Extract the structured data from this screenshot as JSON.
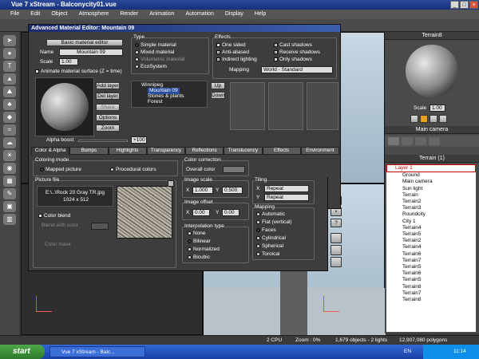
{
  "window": {
    "title": "Vue 7 xStream - Balconycity01.vue",
    "minimize": "_",
    "maximize": "□",
    "close": "×"
  },
  "menu": [
    "File",
    "Edit",
    "Object",
    "Atmosphere",
    "Render",
    "Animation",
    "Automation",
    "Display",
    "Help"
  ],
  "editor": {
    "title": "Advanced Material Editor: Mountain 09",
    "basic_button": "Basic material editor",
    "name_label": "Name",
    "name_value": "Mountain 09",
    "scale_label": "Scale",
    "scale_value": "1.00",
    "animate_label": "Animate material surface (Z = time)",
    "alpha_boost_label": "Alpha boost",
    "alpha_boost_value": "+100",
    "type": {
      "title": "Type",
      "options": [
        "Simple material",
        "Mixed material",
        "Volumetric material",
        "EcoSystem"
      ]
    },
    "effects": {
      "title": "Effects",
      "left": [
        "One sided",
        "Anti-aliased",
        "Indirect lighting"
      ],
      "right": [
        "Cast shadows",
        "Receive shadows",
        "Only shadows"
      ],
      "mapping_label": "Mapping",
      "mapping_value": "World - Standard"
    },
    "layer_buttons": [
      "Add layer",
      "Del layer",
      "Share",
      "Options",
      "Zoom"
    ],
    "layers": [
      "Winnipeg",
      "Mountain 09",
      "Stones & plants",
      "Forest"
    ],
    "up": "Up",
    "down": "Down",
    "tabs": [
      "Color & Alpha",
      "Bumps",
      "Highlights",
      "Transparency",
      "Reflections",
      "Translucency",
      "Effects",
      "Environment"
    ],
    "coloring": {
      "title": "Coloring mode",
      "mapped": "Mapped picture",
      "procedural": "Procedural colors"
    },
    "color_correction": {
      "title": "Color correction",
      "overall": "Overall color"
    },
    "picture": {
      "title": "Picture file",
      "path": "E:\\..\\Rock 20 Gray TR.jpg",
      "size": "1024 x 512",
      "color_blend": "Color blend",
      "blend_with": "Blend with color",
      "color_mask": "Color mask"
    },
    "image_scale": {
      "title": "Image scale",
      "x": "1.000",
      "y": "0.500"
    },
    "image_offset": {
      "title": "Image offset",
      "x": "0.00",
      "y": "0.00"
    },
    "tiling": {
      "title": "Tiling",
      "x": "Repeat",
      "y": "Repeat"
    },
    "interpolation": {
      "title": "Interpolation type",
      "options": [
        "None",
        "Bilinear",
        "Normalized",
        "Bicubic"
      ]
    },
    "mapping": {
      "title": "Mapping",
      "options": [
        "Automatic",
        "Flat (vertical)",
        "Faces",
        "Cylindrical",
        "Spherical",
        "Toroical"
      ]
    },
    "ok": "OK",
    "cancel": "×",
    "help": "?"
  },
  "right_panel": {
    "material_name": "Terrain8",
    "scale_label": "Scale",
    "scale_value": "1.00",
    "camera": "Main camera",
    "terrain_header": "Terrain (1)",
    "tree": [
      "Layer 1",
      "Ground",
      "Main camera",
      "Sun light",
      "Terrain",
      "Terrain2",
      "Terrain3",
      "Roundcity",
      "City 1",
      "Terrain4",
      "Terrain5",
      "Terrain2",
      "Terrain4",
      "Terrain6",
      "Terrain7",
      "Terrain5",
      "Terrain6",
      "Terrain5",
      "Terrain8",
      "Terrain7",
      "Terrain8"
    ]
  },
  "status": {
    "cpu": "2 CPU",
    "zoom": "Zoom : 0%",
    "objects": "1,679 objects - 2 lights",
    "polygons": "12,907,080 polygons"
  },
  "taskbar": {
    "start": "start",
    "task": "Vue 7 xStream - Balc...",
    "lang": "EN",
    "time": "11:14"
  }
}
